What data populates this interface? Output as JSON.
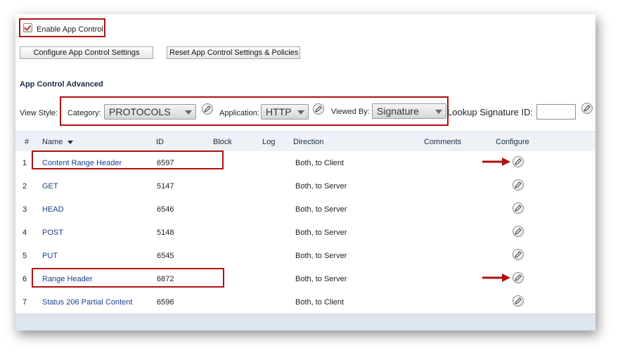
{
  "enable_app_control": {
    "label": "Enable App Control",
    "checked": true
  },
  "buttons": {
    "configure": "Configure App Control Settings",
    "reset": "Reset App Control Settings & Policies"
  },
  "advanced": {
    "title": "App Control Advanced",
    "view_style_label": "View Style:",
    "category_label": "Category:",
    "category_value": "PROTOCOLS",
    "application_label": "Application:",
    "application_value": "HTTP",
    "viewed_by_label": "Viewed By:",
    "viewed_by_value": "Signature",
    "lookup_label": "Lookup Signature ID:",
    "lookup_value": ""
  },
  "table": {
    "headers": [
      "#",
      "Name",
      "ID",
      "Block",
      "Log",
      "Direction",
      "Comments",
      "Configure"
    ],
    "rows": [
      {
        "num": "1",
        "name": "Content Range Header",
        "id": "6597",
        "direction": "Both, to Client"
      },
      {
        "num": "2",
        "name": "GET",
        "id": "5147",
        "direction": "Both, to Server"
      },
      {
        "num": "3",
        "name": "HEAD",
        "id": "6546",
        "direction": "Both, to Server"
      },
      {
        "num": "4",
        "name": "POST",
        "id": "5148",
        "direction": "Both, to Server"
      },
      {
        "num": "5",
        "name": "PUT",
        "id": "6545",
        "direction": "Both, to Server"
      },
      {
        "num": "6",
        "name": "Range Header",
        "id": "6872",
        "direction": "Both, to Server"
      },
      {
        "num": "7",
        "name": "Status 206 Partial Content",
        "id": "6596",
        "direction": "Both, to Client"
      }
    ]
  },
  "colors": {
    "highlight": "#b01111",
    "link": "#1a3f8f",
    "header_bg": "#eef2f7"
  }
}
